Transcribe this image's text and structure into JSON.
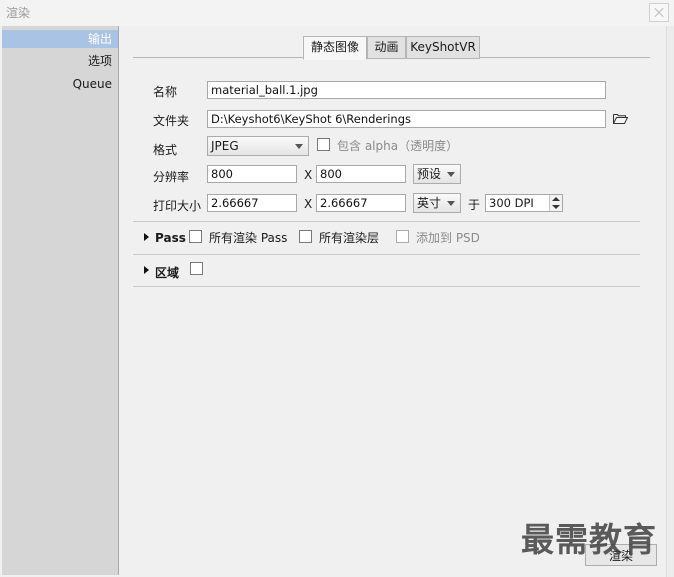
{
  "window": {
    "title": "渲染"
  },
  "sidebar": {
    "items": [
      {
        "label": "输出",
        "selected": true
      },
      {
        "label": "选项",
        "selected": false
      },
      {
        "label": "Queue",
        "selected": false
      }
    ]
  },
  "tabs": [
    {
      "label": "静态图像",
      "active": true
    },
    {
      "label": "动画",
      "active": false
    },
    {
      "label": "KeyShotVR",
      "active": false
    }
  ],
  "form": {
    "name_label": "名称",
    "name_value": "material_ball.1.jpg",
    "folder_label": "文件夹",
    "folder_value": "D:\\Keyshot6\\KeyShot 6\\Renderings",
    "format_label": "格式",
    "format_value": "JPEG",
    "alpha_label": "包含 alpha（透明度）",
    "alpha_checked": false,
    "resolution_label": "分辨率",
    "res_width": "800",
    "res_x": "X",
    "res_height": "800",
    "preset_label": "预设",
    "print_label": "打印大小",
    "print_width": "2.66667",
    "print_x": "X",
    "print_height": "2.66667",
    "unit_value": "英寸",
    "at_label": "于",
    "dpi_value": "300 DPI"
  },
  "pass": {
    "label": "Pass",
    "all_passes_label": "所有渲染 Pass",
    "all_layers_label": "所有渲染层",
    "add_psd_label": "添加到 PSD"
  },
  "region": {
    "label": "区域"
  },
  "footer": {
    "render_label": "渲染"
  },
  "watermark": "最需教育",
  "colors": {
    "selection": "#a9c3e4",
    "sidebar_bg": "#d6d6d6",
    "panel_bg": "#f0f0f0"
  }
}
